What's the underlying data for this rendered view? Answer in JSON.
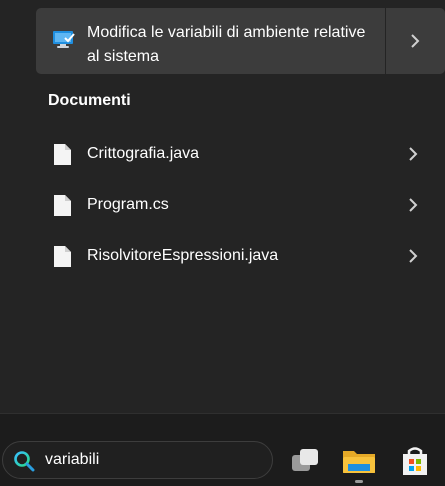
{
  "top_result": {
    "title": "Modifica le variabili di ambiente relative al sistema",
    "icon": "system-properties-icon"
  },
  "documents": {
    "heading": "Documenti",
    "items": [
      {
        "label": "Crittografia.java",
        "icon": "file-icon"
      },
      {
        "label": "Program.cs",
        "icon": "file-icon"
      },
      {
        "label": "RisolvitoreEspressioni.java",
        "icon": "file-icon"
      }
    ]
  },
  "taskbar": {
    "search_value": "variabili",
    "apps": [
      "task-view-icon",
      "file-explorer-icon",
      "microsoft-store-icon"
    ]
  },
  "colors": {
    "panel": "#242424",
    "highlight": "#3c3c3c",
    "taskbar": "#1c1c1c",
    "folder": "#f7c23c",
    "accent": "#1f8fe0"
  }
}
